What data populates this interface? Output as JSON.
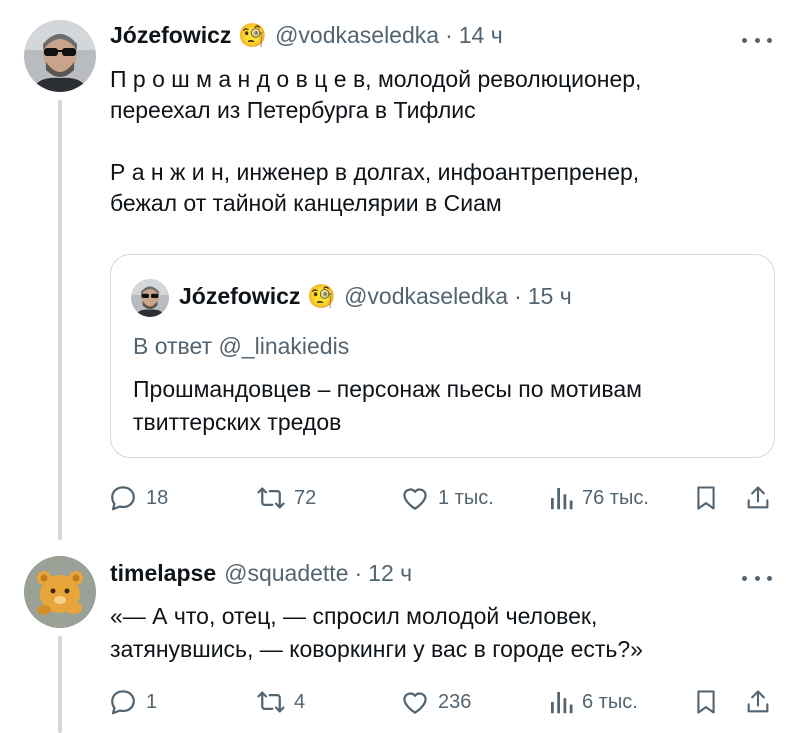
{
  "tweet1": {
    "author_name": "Józefowicz",
    "author_emoji": "🧐",
    "handle": "@vodkaseledka",
    "separator": "·",
    "time": "14 ч",
    "lines": [
      "П р о ш м а н д о в ц е в, молодой революционер,",
      "переехал из Петербурга в Тифлис",
      "Р а н ж и н, инженер в долгах, инфоантрепренер,",
      "бежал от тайной канцелярии в Сиам"
    ],
    "quote": {
      "author_name": "Józefowicz",
      "author_emoji": "🧐",
      "handle": "@vodkaseledka",
      "separator": "·",
      "time": "15 ч",
      "reply_to": "В ответ @_linakiedis",
      "lines": [
        "Прошмандовцев – персонаж пьесы по мотивам",
        "твиттерских тредов"
      ]
    },
    "actions": {
      "replies": "18",
      "retweets": "72",
      "likes": "1 тыс.",
      "views": "76 тыс."
    }
  },
  "tweet2": {
    "author_name": "timelapse",
    "handle": "@squadette",
    "separator": "·",
    "time": "12 ч",
    "lines": [
      "«— А что, отец, — спросил молодой человек,",
      "затянувшись, — коворкинги у вас в городе есть?»"
    ],
    "actions": {
      "replies": "1",
      "retweets": "4",
      "likes": "236",
      "views": "6 тыс."
    }
  },
  "icons": {
    "reply": "reply-icon",
    "retweet": "retweet-icon",
    "like": "heart-icon",
    "views": "views-icon",
    "bookmark": "bookmark-icon",
    "share": "share-icon",
    "more": "more-icon"
  },
  "colors": {
    "text": "#0f1419",
    "secondary": "#536471",
    "border": "#cfd9de"
  }
}
